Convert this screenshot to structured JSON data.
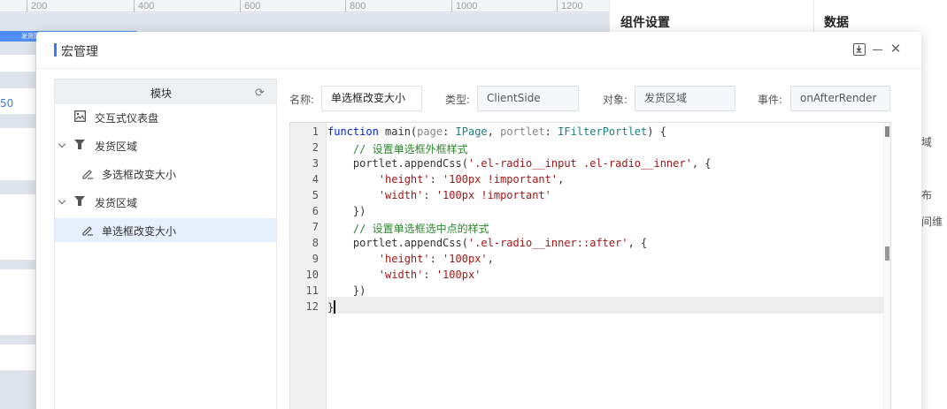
{
  "ruler": {
    "ticks": [
      "200",
      "400",
      "600",
      "800",
      "1000",
      "1200"
    ]
  },
  "background": {
    "blue_tag": "发货区",
    "number": "50"
  },
  "right_panel": {
    "component_settings": "组件设置",
    "data": "数据",
    "fragments": [
      "域",
      "布",
      "间维"
    ]
  },
  "dialog": {
    "title": "宏管理",
    "module_panel": {
      "header": "模块",
      "items": [
        {
          "label": "交互式仪表盘"
        },
        {
          "label": "发货区域"
        },
        {
          "label": "多选框改变大小"
        },
        {
          "label": "发货区域"
        },
        {
          "label": "单选框改变大小"
        }
      ]
    },
    "fields": {
      "name_label": "名称:",
      "name_value": "单选框改变大小",
      "type_label": "类型:",
      "type_value": "ClientSide",
      "object_label": "对象:",
      "object_value": "发货区域",
      "event_label": "事件:",
      "event_value": "onAfterRender"
    },
    "editor": {
      "line_numbers": [
        "1",
        "2",
        "3",
        "4",
        "5",
        "6",
        "7",
        "8",
        "9",
        "10",
        "11",
        "12"
      ],
      "code": {
        "l1_kw": "function",
        "l1_name": " main(",
        "l1_p1": "page",
        "l1_c1": ": ",
        "l1_t1": "IPage",
        "l1_c2": ", ",
        "l1_p2": "portlet",
        "l1_c3": ": ",
        "l1_t2": "IFilterPortlet",
        "l1_end": ") {",
        "l2": "    // 设置单选框外框样式",
        "l3_a": "    portlet.appendCss(",
        "l3_s": "'.el-radio__input .el-radio__inner'",
        "l3_b": ", {",
        "l4_s1": "        'height'",
        "l4_c": ": ",
        "l4_s2": "'100px !important'",
        "l4_e": ",",
        "l5_s1": "        'width'",
        "l5_c": ": ",
        "l5_s2": "'100px !important'",
        "l6": "    })",
        "l7": "    // 设置单选框选中点的样式",
        "l8_a": "    portlet.appendCss(",
        "l8_s": "'.el-radio__inner::after'",
        "l8_b": ", {",
        "l9_s1": "        'height'",
        "l9_c": ": ",
        "l9_s2": "'100px'",
        "l9_e": ",",
        "l10_s1": "        'width'",
        "l10_c": ": ",
        "l10_s2": "'100px'",
        "l11": "    })",
        "l12": "}"
      }
    }
  }
}
